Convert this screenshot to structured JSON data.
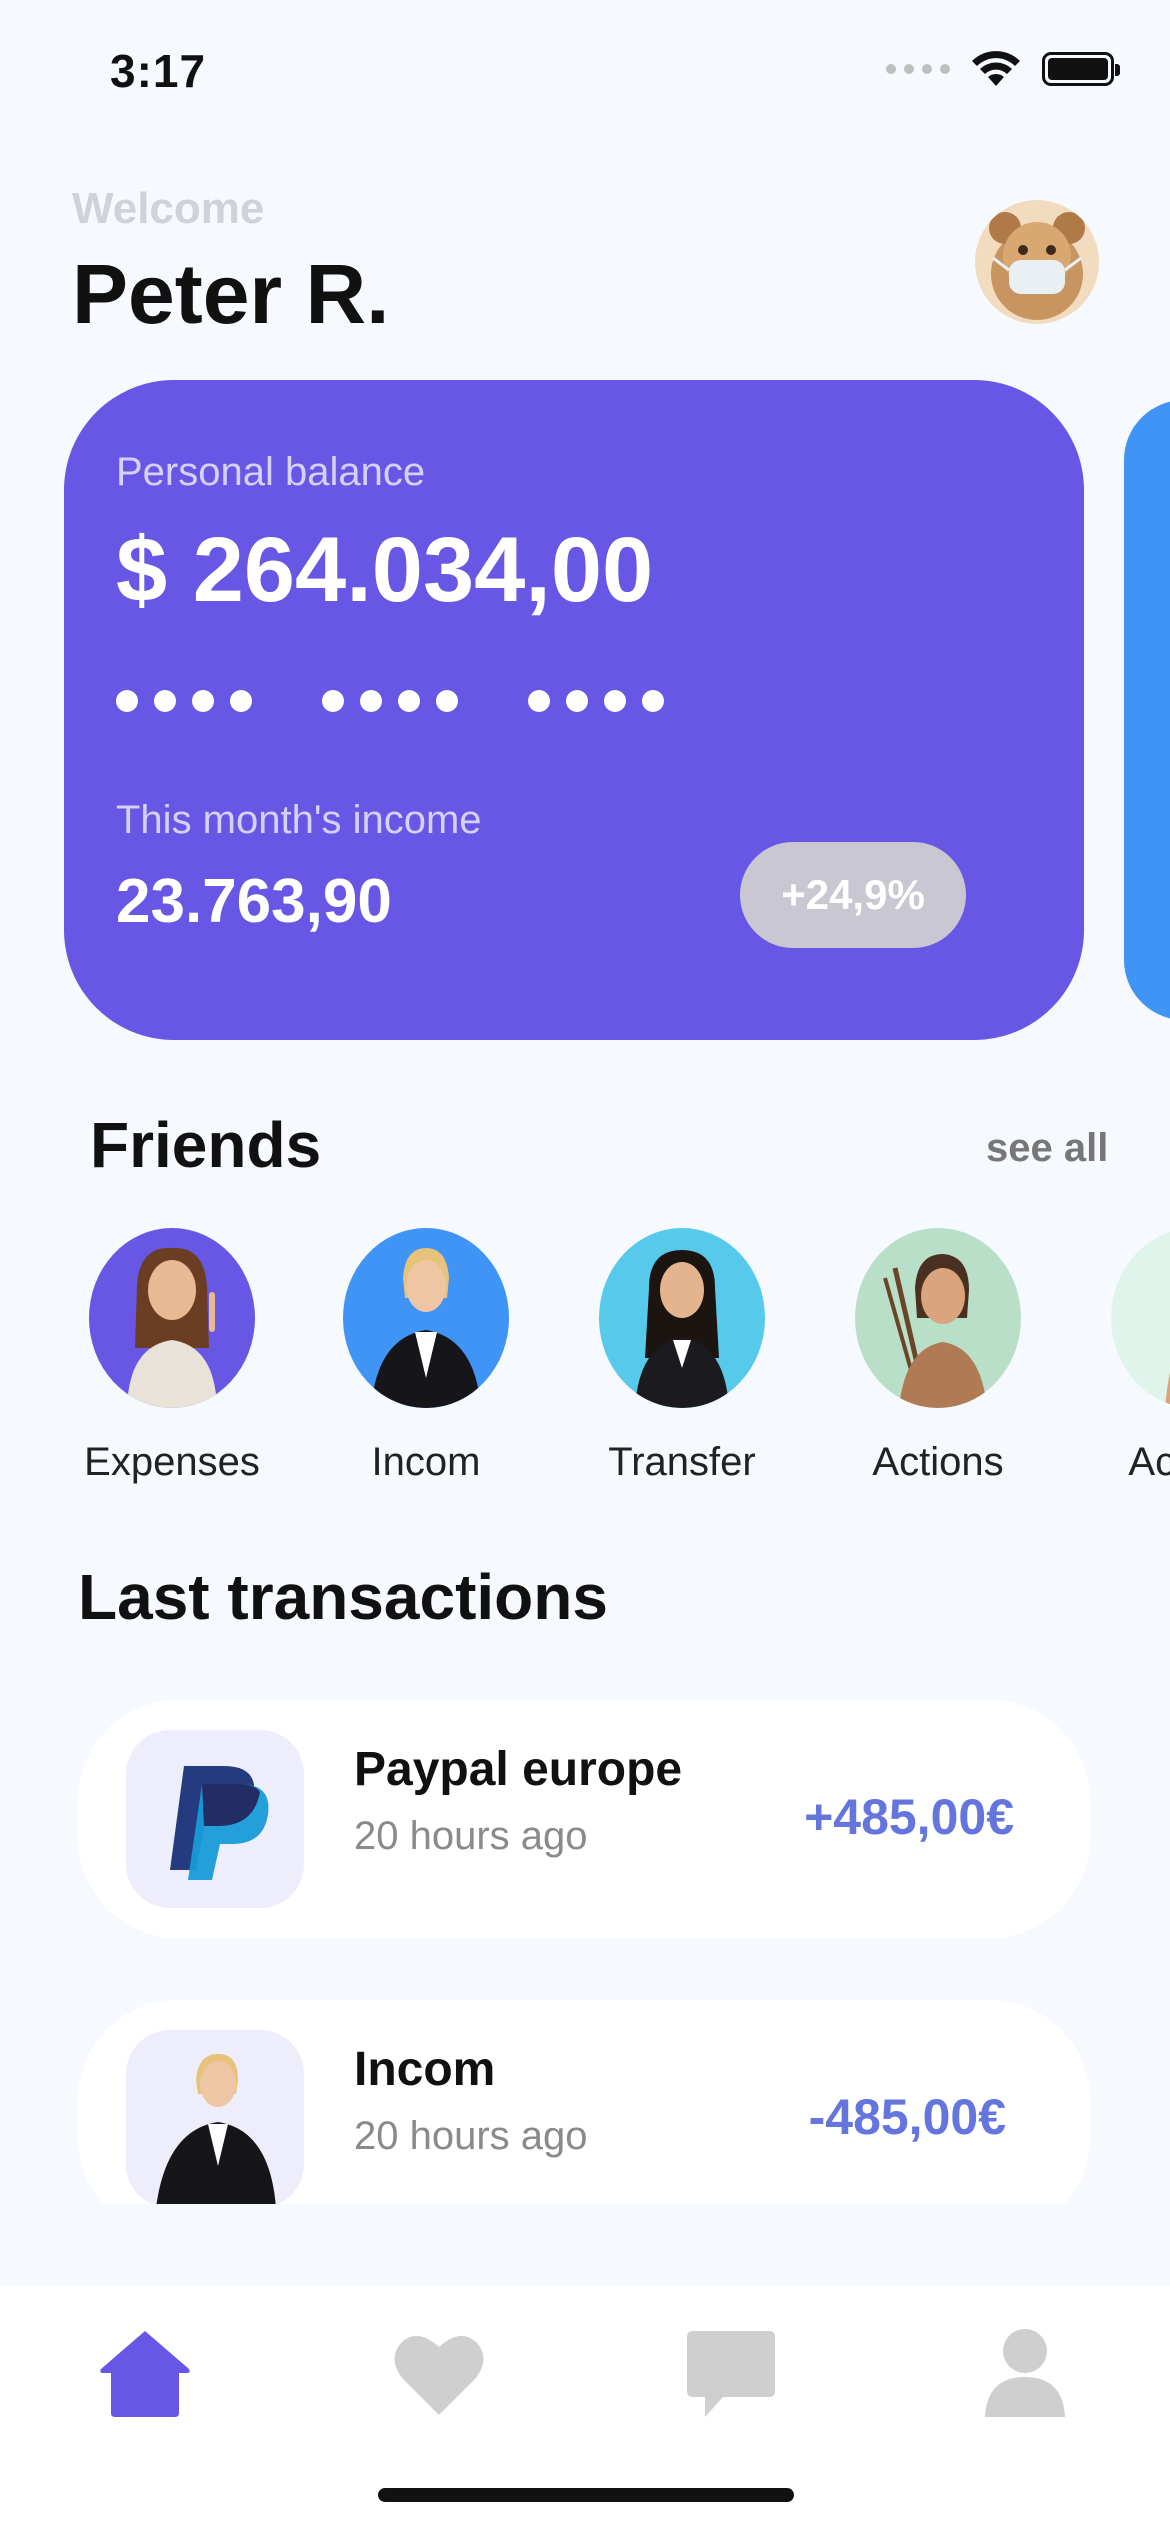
{
  "status_bar": {
    "time": "3:17"
  },
  "header": {
    "welcome": "Welcome",
    "name": "Peter R."
  },
  "balance_card": {
    "label": "Personal balance",
    "amount": "$ 264.034,00",
    "income_label": "This month's income",
    "income_amount": "23.763,90",
    "growth": "+24,9%"
  },
  "friends": {
    "title": "Friends",
    "see_all": "see all",
    "items": [
      {
        "label": "Expenses",
        "bg": "#6757e4"
      },
      {
        "label": "Incom",
        "bg": "#3f94f5"
      },
      {
        "label": "Transfer",
        "bg": "#57c9ea"
      },
      {
        "label": "Actions",
        "bg": "#b9dfc9"
      },
      {
        "label": "Actions",
        "bg": "#dff5ec"
      }
    ]
  },
  "transactions": {
    "title": "Last transactions",
    "items": [
      {
        "name": "Paypal europe",
        "time": "20 hours ago",
        "amount": "+485,00€"
      },
      {
        "name": "Incom",
        "time": "20 hours ago",
        "amount": "-485,00€"
      }
    ]
  },
  "nav": {
    "items": [
      "home-icon",
      "heart-icon",
      "chat-icon",
      "profile-icon"
    ],
    "active_color": "#6757e4",
    "inactive_color": "#cfcfcf"
  }
}
